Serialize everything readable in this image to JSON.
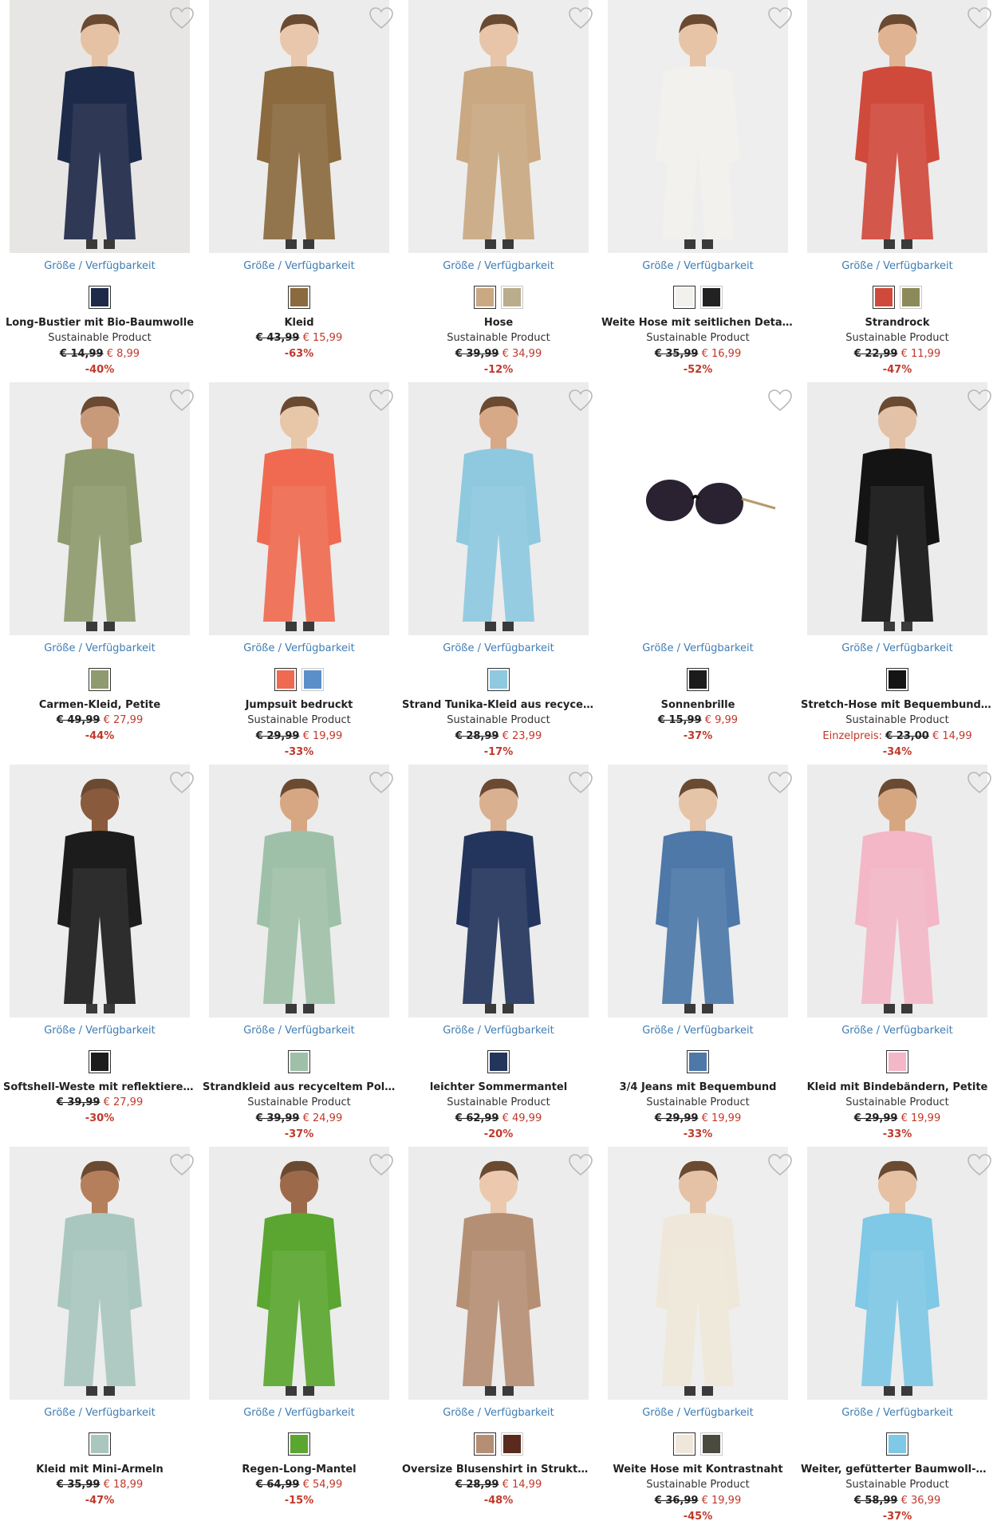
{
  "colors": {
    "link": "#3f7db3",
    "sale": "#c0392b",
    "text": "#222222"
  },
  "common": {
    "size_availability": "Größe / Verfügbarkeit",
    "sustainable": "Sustainable Product",
    "heart_icon": "heart-icon"
  },
  "products": [
    {
      "name": "Long-Bustier mit Bio-Baumwolle",
      "sustainable": true,
      "old_price": "€ 14,99",
      "new_price": "€ 8,99",
      "discount": "-40%",
      "bg": "#e8e6e4",
      "garment": "#1e2a4a",
      "skin": "#e6c2a4",
      "swatches": [
        "#1e2a4a"
      ]
    },
    {
      "name": "Kleid",
      "sustainable": false,
      "old_price": "€ 43,99",
      "new_price": "€ 15,99",
      "discount": "-63%",
      "bg": "#ececec",
      "garment": "#8a6a3e",
      "skin": "#e9c7ad",
      "swatches": [
        "#8a6a3e"
      ]
    },
    {
      "name": "Hose",
      "sustainable": true,
      "old_price": "€ 39,99",
      "new_price": "€ 34,99",
      "discount": "-12%",
      "bg": "#ededed",
      "garment": "#c9a882",
      "skin": "#e8c5a8",
      "swatches": [
        "#c9a882",
        "#b9ad8c"
      ]
    },
    {
      "name": "Weite Hose mit seitlichen Details",
      "sustainable": true,
      "old_price": "€ 35,99",
      "new_price": "€ 16,99",
      "discount": "-52%",
      "bg": "#eeeeee",
      "garment": "#f3f1ee",
      "skin": "#e7c4a6",
      "swatches": [
        "#f3f1ee",
        "#222222"
      ]
    },
    {
      "name": "Strandrock",
      "sustainable": true,
      "old_price": "€ 22,99",
      "new_price": "€ 11,99",
      "discount": "-47%",
      "bg": "#ececec",
      "garment": "#d04a3c",
      "skin": "#e0b392",
      "swatches": [
        "#d04a3c",
        "#8c8a5a"
      ]
    },
    {
      "name": "Carmen-Kleid, Petite",
      "sustainable": false,
      "old_price": "€ 49,99",
      "new_price": "€ 27,99",
      "discount": "-44%",
      "bg": "#ededed",
      "garment": "#8f9a6e",
      "skin": "#c99a7a",
      "swatches": [
        "#8f9a6e"
      ]
    },
    {
      "name": "Jumpsuit bedruckt",
      "sustainable": true,
      "old_price": "€ 29,99",
      "new_price": "€ 19,99",
      "discount": "-33%",
      "bg": "#ececec",
      "garment": "#ef6a50",
      "skin": "#e8c6a8",
      "swatches": [
        "#ef6a50",
        "#5b8fc9"
      ]
    },
    {
      "name": "Strand Tunika-Kleid aus recyceltem Polyester",
      "sustainable": true,
      "old_price": "€ 28,99",
      "new_price": "€ 23,99",
      "discount": "-17%",
      "bg": "#ececec",
      "garment": "#8ec9df",
      "skin": "#d8a987",
      "swatches": [
        "#8ec9df"
      ]
    },
    {
      "name": "Sonnenbrille",
      "sustainable": false,
      "old_price": "€ 15,99",
      "new_price": "€ 9,99",
      "discount": "-37%",
      "bg": "#ffffff",
      "garment": "#1b1b1b",
      "skin": "#ffffff",
      "swatches": [
        "#1b1b1b"
      ]
    },
    {
      "name": "Stretch-Hose mit Bequembund, Straight",
      "sustainable": true,
      "label": "Einzelpreis:",
      "old_price": "€ 23,00",
      "new_price": "€ 14,99",
      "discount": "-34%",
      "bg": "#ececec",
      "garment": "#141414",
      "skin": "#e4c2a8",
      "swatches": [
        "#141414"
      ]
    },
    {
      "name": "Softshell-Weste mit reflektierenden Details",
      "sustainable": false,
      "old_price": "€ 39,99",
      "new_price": "€ 27,99",
      "discount": "-30%",
      "bg": "#ededed",
      "garment": "#1c1c1c",
      "skin": "#8a5a3c",
      "swatches": [
        "#1c1c1c"
      ]
    },
    {
      "name": "Strandkleid aus recyceltem Polyester",
      "sustainable": true,
      "old_price": "€ 39,99",
      "new_price": "€ 24,99",
      "discount": "-37%",
      "bg": "#ececec",
      "garment": "#9fc0a8",
      "skin": "#d7a783",
      "swatches": [
        "#9fc0a8"
      ]
    },
    {
      "name": "leichter Sommermantel",
      "sustainable": true,
      "old_price": "€ 62,99",
      "new_price": "€ 49,99",
      "discount": "-20%",
      "bg": "#ececec",
      "garment": "#23355c",
      "skin": "#d9b090",
      "swatches": [
        "#23355c"
      ]
    },
    {
      "name": "3/4 Jeans mit Bequembund",
      "sustainable": true,
      "old_price": "€ 29,99",
      "new_price": "€ 19,99",
      "discount": "-33%",
      "bg": "#eeeeee",
      "garment": "#4d78a8",
      "skin": "#e5c4a8",
      "swatches": [
        "#4d78a8"
      ]
    },
    {
      "name": "Kleid mit Bindebändern, Petite",
      "sustainable": true,
      "old_price": "€ 29,99",
      "new_price": "€ 19,99",
      "discount": "-33%",
      "bg": "#ececec",
      "garment": "#f3b7c8",
      "skin": "#d6a680",
      "swatches": [
        "#f3b7c8"
      ]
    },
    {
      "name": "Kleid mit Mini-Ärmeln",
      "sustainable": false,
      "old_price": "€ 35,99",
      "new_price": "€ 18,99",
      "discount": "-47%",
      "bg": "#ededed",
      "garment": "#a9c7bf",
      "skin": "#b57f5c",
      "swatches": [
        "#a9c7bf"
      ]
    },
    {
      "name": "Regen-Long-Mantel",
      "sustainable": false,
      "old_price": "€ 64,99",
      "new_price": "€ 54,99",
      "discount": "-15%",
      "bg": "#ececec",
      "garment": "#5aa630",
      "skin": "#9c6a4a",
      "swatches": [
        "#5aa630"
      ]
    },
    {
      "name": "Oversize Blusenshirt in Strukturware",
      "sustainable": false,
      "old_price": "€ 28,99",
      "new_price": "€ 14,99",
      "discount": "-48%",
      "bg": "#ececec",
      "garment": "#b58f74",
      "skin": "#ecc9ae",
      "swatches": [
        "#b58f74",
        "#5a2a1e"
      ]
    },
    {
      "name": "Weite Hose mit Kontrastnaht",
      "sustainable": true,
      "old_price": "€ 36,99",
      "new_price": "€ 19,99",
      "discount": "-45%",
      "bg": "#eeeeee",
      "garment": "#efe8da",
      "skin": "#e5c2a6",
      "swatches": [
        "#efe8da",
        "#4a4a3e"
      ]
    },
    {
      "name": "Weiter, gefütterter Baumwoll-Mantel",
      "sustainable": true,
      "old_price": "€ 58,99",
      "new_price": "€ 36,99",
      "discount": "-37%",
      "bg": "#ececec",
      "garment": "#7fc8e6",
      "skin": "#e6c1a3",
      "swatches": [
        "#7fc8e6"
      ]
    }
  ]
}
